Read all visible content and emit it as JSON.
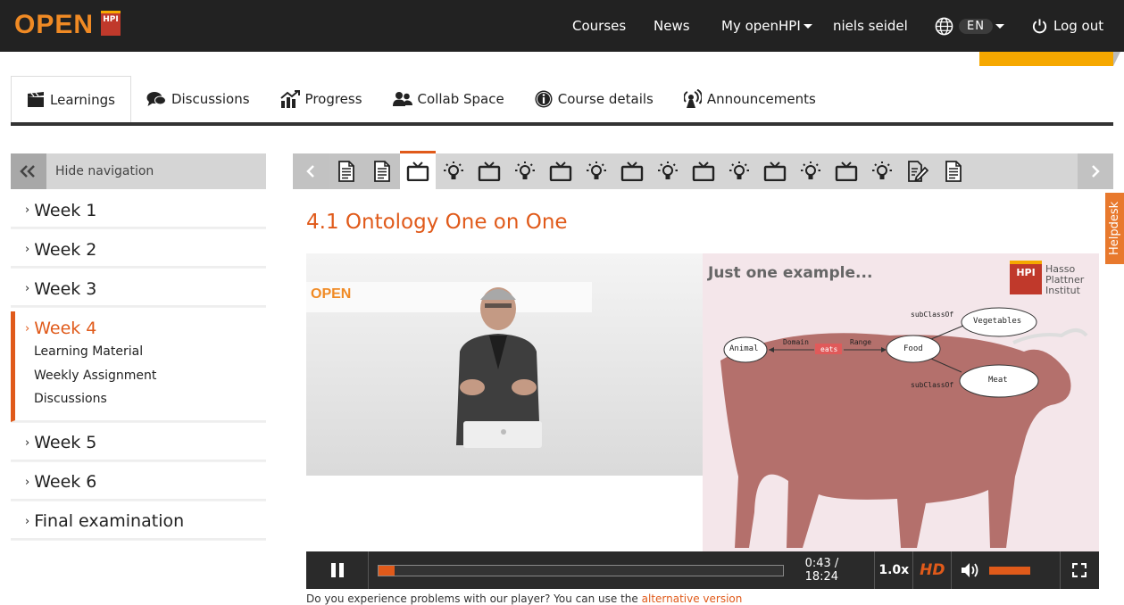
{
  "header": {
    "logo_text": "OPEN",
    "logo_badge": "HPI",
    "nav": {
      "courses": "Courses",
      "news": "News",
      "my_openhpi": "My openHPI",
      "user": "niels seidel",
      "language": "EN",
      "logout": "Log out"
    }
  },
  "tabs": [
    {
      "label": "Learnings"
    },
    {
      "label": "Discussions"
    },
    {
      "label": "Progress"
    },
    {
      "label": "Collab Space"
    },
    {
      "label": "Course details"
    },
    {
      "label": "Announcements"
    }
  ],
  "sidebar": {
    "hide_label": "Hide navigation",
    "weeks": [
      {
        "label": "Week 1"
      },
      {
        "label": "Week 2"
      },
      {
        "label": "Week 3"
      },
      {
        "label": "Week 4",
        "items": [
          "Learning Material",
          "Weekly Assignment",
          "Discussions"
        ]
      },
      {
        "label": "Week 5"
      },
      {
        "label": "Week 6"
      },
      {
        "label": "Final examination"
      }
    ]
  },
  "item_bar": {
    "items": [
      "text",
      "text",
      "video",
      "quiz",
      "video",
      "quiz",
      "video",
      "quiz",
      "video",
      "quiz",
      "video",
      "quiz",
      "video",
      "quiz",
      "video",
      "quiz",
      "assignment",
      "text"
    ],
    "current_index": 2
  },
  "content": {
    "title": "4.1 Ontology One on One",
    "slide": {
      "heading": "Just one example...",
      "hpi_logo": "HPI",
      "institute": [
        "Hasso",
        "Plattner",
        "Institut"
      ],
      "nodes": {
        "animal": "Animal",
        "food": "Food",
        "vegetables": "Vegetables",
        "meat": "Meat"
      },
      "edges": {
        "domain": "Domain",
        "range": "Range",
        "eats": "eats",
        "subclass_top": "subClassOf",
        "subclass_bottom": "subClassOf"
      }
    },
    "lecture_logo": "OPEN",
    "player": {
      "time": "0:43 / 18:24",
      "speed": "1.0x",
      "hd": "HD",
      "progress": 0.039,
      "volume": 1.0,
      "accent": "#e05a1a"
    },
    "footer_text": "Do you experience problems with our player? You can use the",
    "footer_link": "alternative version"
  },
  "helpdesk": "Helpdesk"
}
